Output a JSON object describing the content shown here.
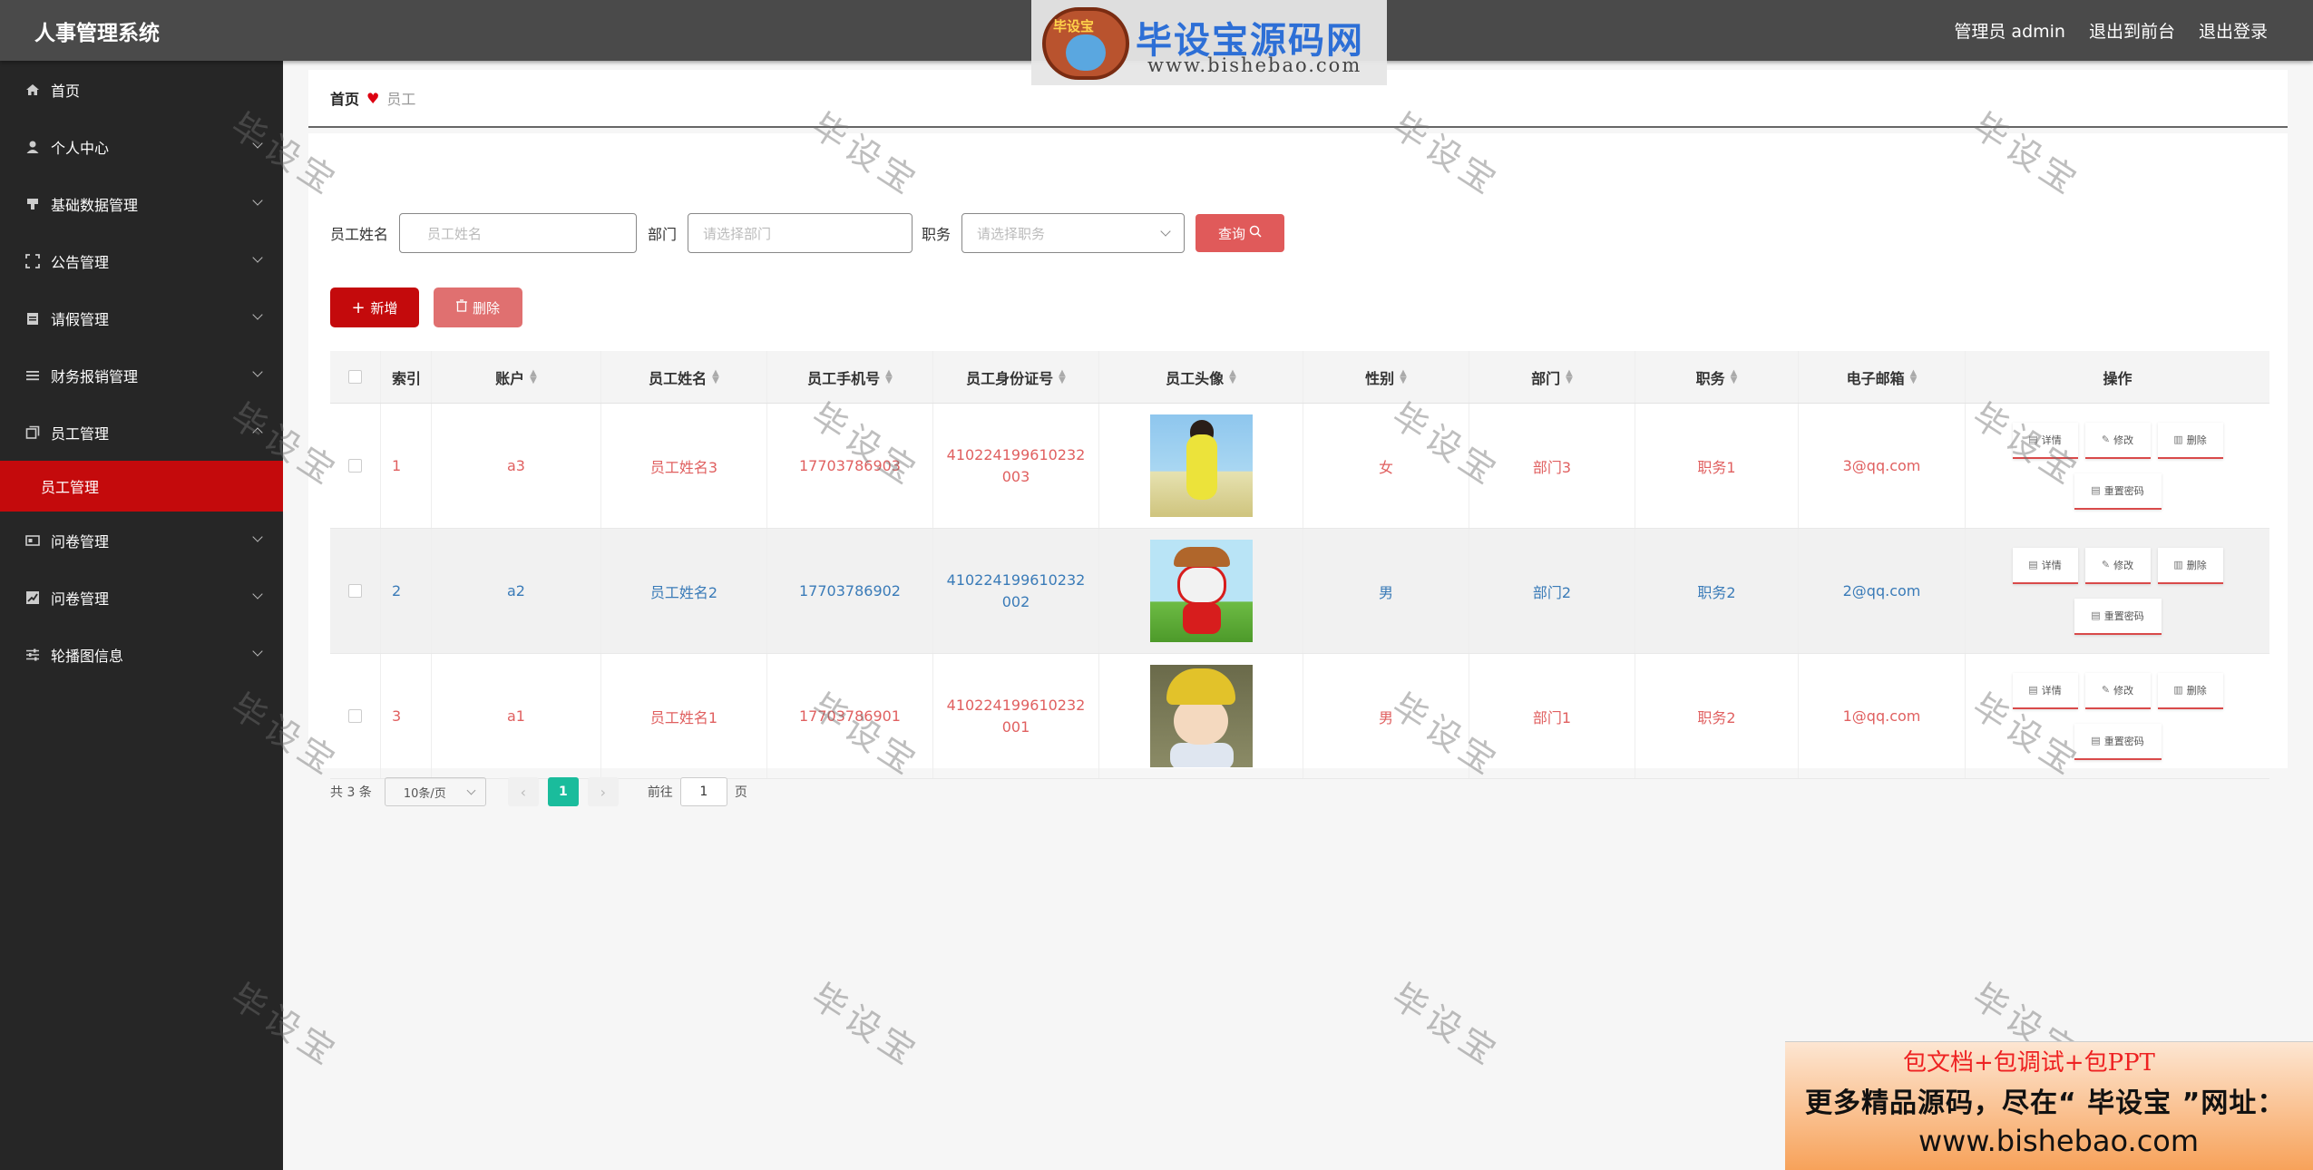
{
  "app": {
    "title": "人事管理系统"
  },
  "header": {
    "user_label": "管理员 admin",
    "front_link": "退出到前台",
    "logout_link": "退出登录"
  },
  "logo": {
    "brand": "毕设宝源码网",
    "emblem_text": "毕设宝",
    "url": "www.bishebao.com"
  },
  "sidebar": {
    "items": [
      {
        "label": "首页",
        "icon": "home-icon"
      },
      {
        "label": "个人中心",
        "icon": "user-icon"
      },
      {
        "label": "基础数据管理",
        "icon": "data-icon"
      },
      {
        "label": "公告管理",
        "icon": "notice-icon"
      },
      {
        "label": "请假管理",
        "icon": "leave-icon"
      },
      {
        "label": "财务报销管理",
        "icon": "list-icon"
      },
      {
        "label": "员工管理",
        "icon": "staff-icon"
      },
      {
        "label": "员工管理",
        "icon": "none"
      },
      {
        "label": "问卷管理",
        "icon": "survey-icon"
      },
      {
        "label": "问卷管理",
        "icon": "chart-icon"
      },
      {
        "label": "轮播图信息",
        "icon": "slider-icon"
      }
    ],
    "active_color": "#c40a0c"
  },
  "breadcrumb": {
    "home": "首页",
    "current": "员工"
  },
  "search": {
    "name_label": "员工姓名",
    "name_placeholder": "员工姓名",
    "dept_label": "部门",
    "dept_placeholder": "请选择部门",
    "job_label": "职务",
    "job_placeholder": "请选择职务",
    "query_button": "查询"
  },
  "actions": {
    "add": "新增",
    "delete": "删除"
  },
  "table": {
    "headers": [
      "索引",
      "账户",
      "员工姓名",
      "员工手机号",
      "员工身份证号",
      "员工头像",
      "性别",
      "部门",
      "职务",
      "电子邮箱",
      "操作"
    ],
    "rows": [
      {
        "index": "1",
        "account": "a3",
        "name": "员工姓名3",
        "phone": "17703786903",
        "id_card": "410224199610232003",
        "avatar": "girl-yellow-photo",
        "gender": "女",
        "dept": "部门3",
        "job": "职务1",
        "email": "3@qq.com",
        "color": "red"
      },
      {
        "index": "2",
        "account": "a2",
        "name": "员工姓名2",
        "phone": "17703786902",
        "id_card": "410224199610232002",
        "avatar": "red-cartoon-photo",
        "gender": "男",
        "dept": "部门2",
        "job": "职务2",
        "email": "2@qq.com",
        "color": "blue"
      },
      {
        "index": "3",
        "account": "a1",
        "name": "员工姓名1",
        "phone": "17703786901",
        "id_card": "410224199610232001",
        "avatar": "boy-cartoon-photo",
        "gender": "男",
        "dept": "部门1",
        "job": "职务2",
        "email": "1@qq.com",
        "color": "red"
      }
    ],
    "ops": {
      "detail": "详情",
      "edit": "修改",
      "delete": "删除",
      "reset": "重置密码"
    }
  },
  "pager": {
    "total": "共 3 条",
    "page_size": "10条/页",
    "current_page": "1",
    "goto_label": "前往",
    "goto_value": "1",
    "page_unit": "页"
  },
  "watermark": "毕设宝",
  "ad": {
    "line1": "包文档+包调试+包PPT",
    "line2": "更多精品源码，尽在“ 毕设宝 ”网址：",
    "line3": "www.bishebao.com"
  }
}
